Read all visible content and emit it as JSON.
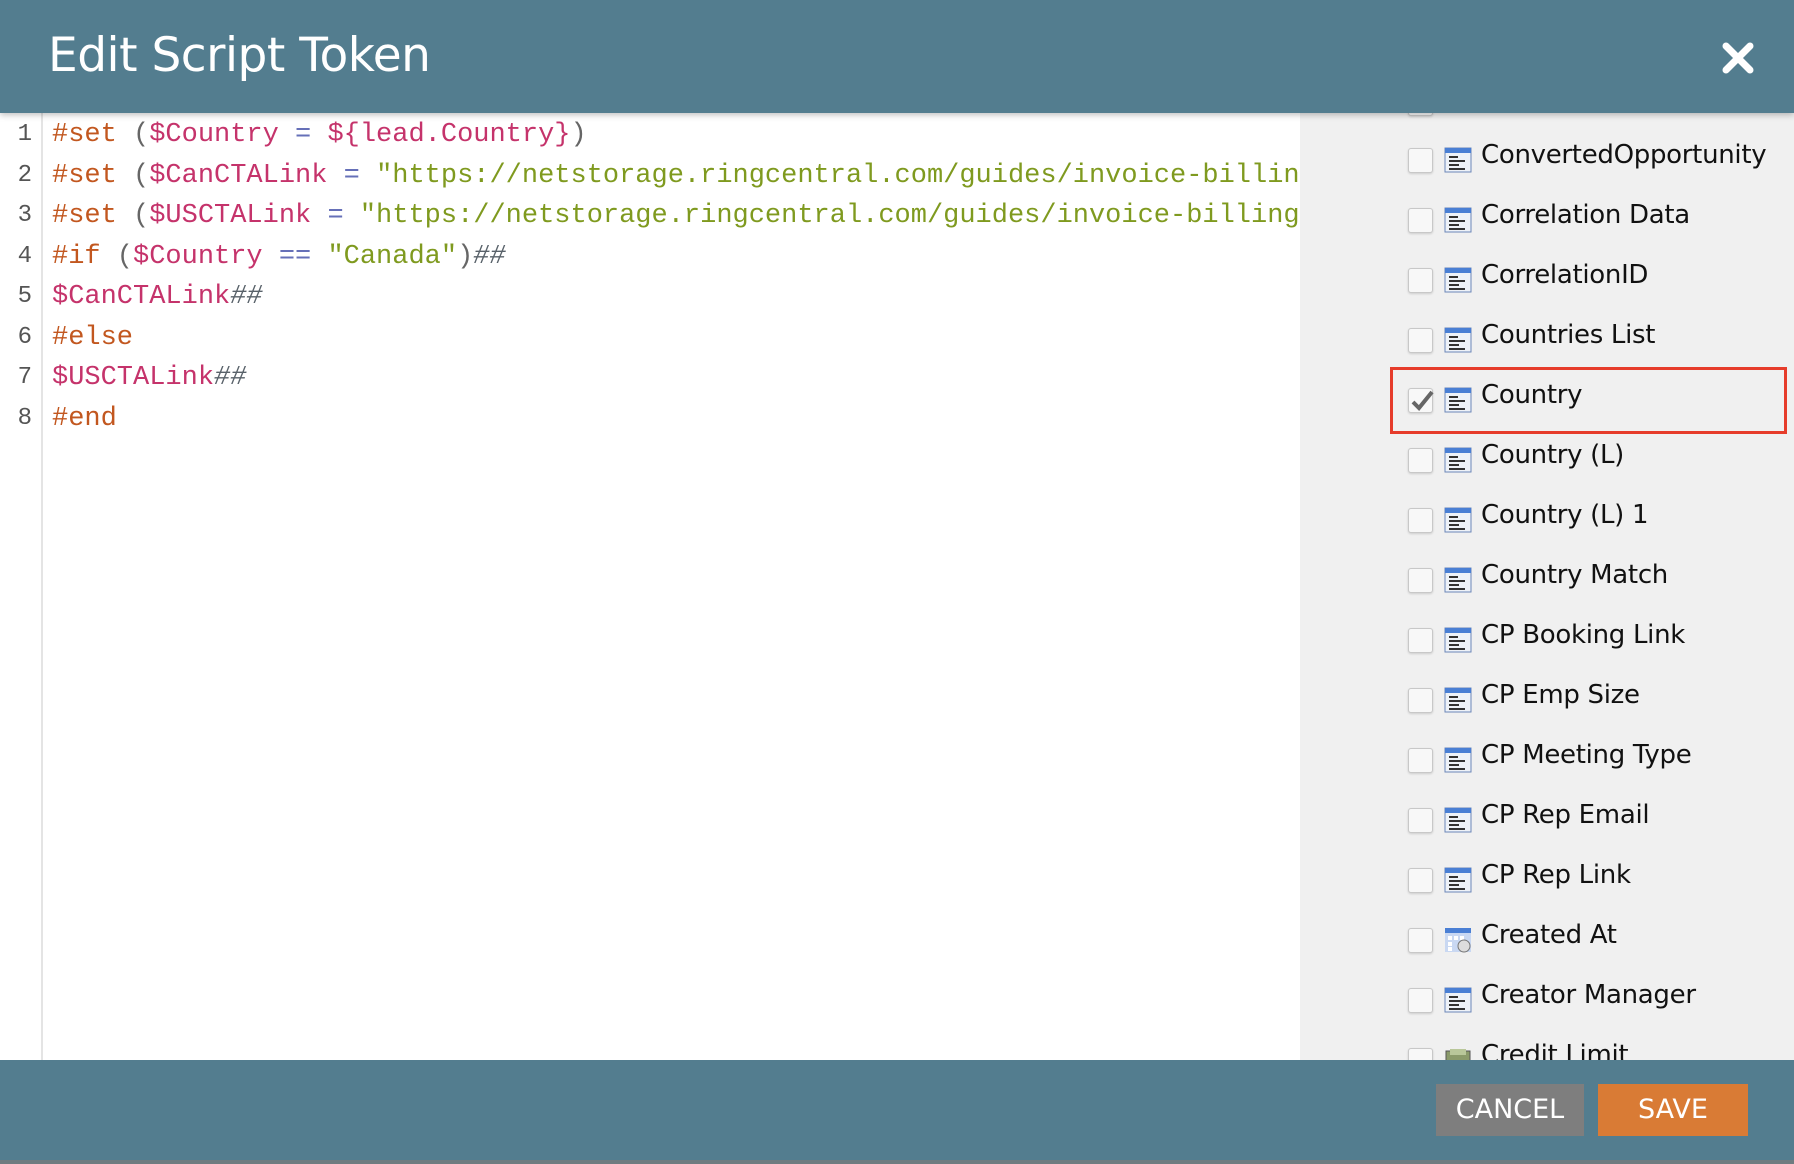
{
  "dialog": {
    "title": "Edit Script Token",
    "close_icon": "close-icon"
  },
  "editor": {
    "lines": [
      {
        "number": "1",
        "tokens": [
          [
            "kw",
            "#set"
          ],
          [
            "pn",
            " ("
          ],
          [
            "var",
            "$Country"
          ],
          [
            "op",
            " = "
          ],
          [
            "var",
            "${lead.Country}"
          ],
          [
            "pn",
            ")"
          ]
        ]
      },
      {
        "number": "2",
        "tokens": [
          [
            "kw",
            "#set"
          ],
          [
            "pn",
            " ("
          ],
          [
            "var",
            "$CanCTALink"
          ],
          [
            "op",
            " = "
          ],
          [
            "str",
            "\"https://netstorage.ringcentral.com/guides/invoice-billing"
          ]
        ]
      },
      {
        "number": "3",
        "tokens": [
          [
            "kw",
            "#set"
          ],
          [
            "pn",
            " ("
          ],
          [
            "var",
            "$USCTALink"
          ],
          [
            "op",
            " = "
          ],
          [
            "str",
            "\"https://netstorage.ringcentral.com/guides/invoice-billing"
          ]
        ]
      },
      {
        "number": "4",
        "tokens": [
          [
            "kw",
            "#if"
          ],
          [
            "pn",
            " ("
          ],
          [
            "var",
            "$Country"
          ],
          [
            "op",
            " == "
          ],
          [
            "str",
            "\"Canada\""
          ],
          [
            "pn",
            ")"
          ],
          [
            "cm",
            "##"
          ]
        ]
      },
      {
        "number": "5",
        "tokens": [
          [
            "var",
            "$CanCTALink"
          ],
          [
            "cm",
            "##"
          ]
        ]
      },
      {
        "number": "6",
        "tokens": [
          [
            "kw",
            "#else"
          ]
        ]
      },
      {
        "number": "7",
        "tokens": [
          [
            "var",
            "$USCTALink"
          ],
          [
            "cm",
            "##"
          ]
        ]
      },
      {
        "number": "8",
        "tokens": [
          [
            "kw",
            "#end"
          ]
        ]
      }
    ]
  },
  "fields": [
    {
      "label": "ConvertedOpportunity",
      "checked": false,
      "icon": "text-field-icon"
    },
    {
      "label": "Correlation Data",
      "checked": false,
      "icon": "text-field-icon"
    },
    {
      "label": "CorrelationID",
      "checked": false,
      "icon": "text-field-icon"
    },
    {
      "label": "Countries List",
      "checked": false,
      "icon": "text-field-icon"
    },
    {
      "label": "Country",
      "checked": true,
      "icon": "text-field-icon",
      "highlighted": true
    },
    {
      "label": "Country (L)",
      "checked": false,
      "icon": "text-field-icon"
    },
    {
      "label": "Country (L) 1",
      "checked": false,
      "icon": "text-field-icon"
    },
    {
      "label": "Country Match",
      "checked": false,
      "icon": "text-field-icon"
    },
    {
      "label": "CP Booking Link",
      "checked": false,
      "icon": "text-field-icon"
    },
    {
      "label": "CP Emp Size",
      "checked": false,
      "icon": "text-field-icon"
    },
    {
      "label": "CP Meeting Type",
      "checked": false,
      "icon": "text-field-icon"
    },
    {
      "label": "CP Rep Email",
      "checked": false,
      "icon": "text-field-icon"
    },
    {
      "label": "CP Rep Link",
      "checked": false,
      "icon": "text-field-icon"
    },
    {
      "label": "Created At",
      "checked": false,
      "icon": "datetime-field-icon"
    },
    {
      "label": "Creator Manager",
      "checked": false,
      "icon": "text-field-icon"
    },
    {
      "label": "Credit Limit",
      "checked": false,
      "icon": "currency-field-icon"
    }
  ],
  "footer": {
    "cancel_label": "CANCEL",
    "save_label": "SAVE"
  },
  "colors": {
    "header": "#537d8f",
    "save": "#d97b35",
    "cancel": "#7e7e7e",
    "highlight": "#e63c2b"
  }
}
